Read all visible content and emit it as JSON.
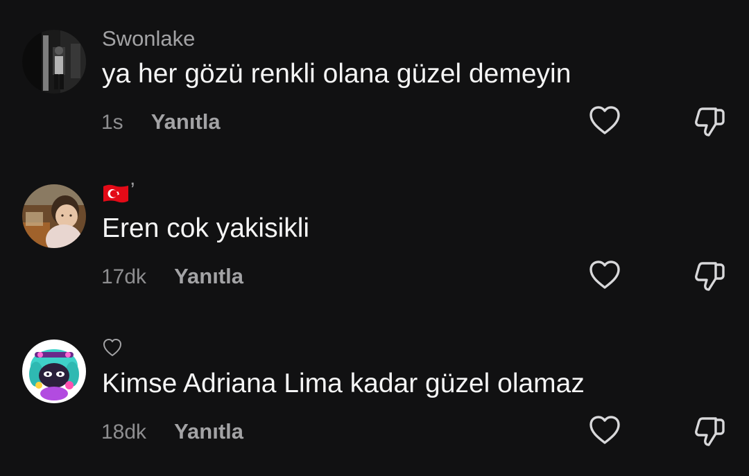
{
  "comments": [
    {
      "username": "Swonlake",
      "username_icon": null,
      "text": "ya her gözü renkli olana güzel demeyin",
      "time": "1s",
      "reply_label": "Yanıtla",
      "avatar_icon": "dark-photo-avatar"
    },
    {
      "username": "",
      "username_icon": "turkey-flag-icon",
      "username_suffix": "ʼ",
      "text": "Eren cok yakisikli",
      "time": "17dk",
      "reply_label": "Yanıtla",
      "avatar_icon": "child-photo-avatar"
    },
    {
      "username": "",
      "username_icon": "small-heart-icon",
      "text": "Kimse Adriana Lima kadar güzel olamaz",
      "time": "18dk",
      "reply_label": "Yanıtla",
      "avatar_icon": "cartoon-character-avatar"
    }
  ],
  "icons": {
    "like": "heart-outline-icon",
    "dislike": "thumbs-down-outline-icon"
  },
  "colors": {
    "background": "#111112",
    "username": "#a3a3a5",
    "text": "#f5f5f5",
    "meta": "#8e8e90",
    "icon": "#d8d8da"
  }
}
